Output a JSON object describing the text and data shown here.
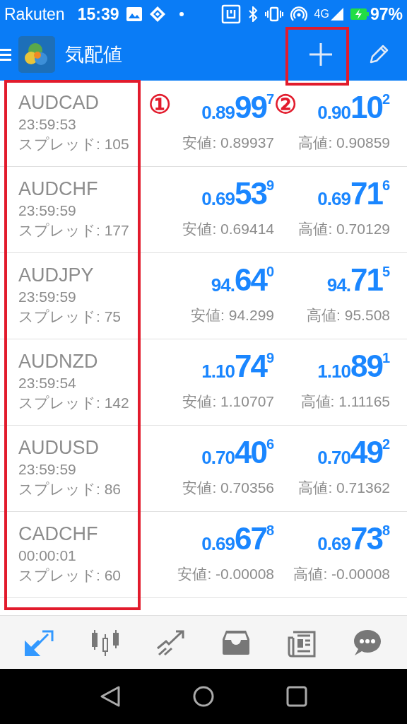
{
  "status_bar": {
    "carrier": "Rakuten",
    "time": "15:39",
    "network": "4G",
    "battery": "97%"
  },
  "app_bar": {
    "title": "気配値"
  },
  "quotes": [
    {
      "symbol": "AUDCAD",
      "time": "23:59:53",
      "spread": "スプレッド: 105",
      "bid": {
        "prefix": "0.89",
        "big": "99",
        "sup": "7",
        "marker": "①"
      },
      "ask": {
        "prefix": "0.90",
        "big": "10",
        "sup": "2",
        "marker": "②"
      },
      "low": "安値: 0.89937",
      "high": "高値: 0.90859"
    },
    {
      "symbol": "AUDCHF",
      "time": "23:59:59",
      "spread": "スプレッド: 177",
      "bid": {
        "prefix": "0.69",
        "big": "53",
        "sup": "9"
      },
      "ask": {
        "prefix": "0.69",
        "big": "71",
        "sup": "6"
      },
      "low": "安値: 0.69414",
      "high": "高値: 0.70129"
    },
    {
      "symbol": "AUDJPY",
      "time": "23:59:59",
      "spread": "スプレッド: 75",
      "bid": {
        "prefix": "94.",
        "big": "64",
        "sup": "0"
      },
      "ask": {
        "prefix": "94.",
        "big": "71",
        "sup": "5"
      },
      "low": "安値: 94.299",
      "high": "高値: 95.508"
    },
    {
      "symbol": "AUDNZD",
      "time": "23:59:54",
      "spread": "スプレッド: 142",
      "bid": {
        "prefix": "1.10",
        "big": "74",
        "sup": "9"
      },
      "ask": {
        "prefix": "1.10",
        "big": "89",
        "sup": "1"
      },
      "low": "安値: 1.10707",
      "high": "高値: 1.11165"
    },
    {
      "symbol": "AUDUSD",
      "time": "23:59:59",
      "spread": "スプレッド: 86",
      "bid": {
        "prefix": "0.70",
        "big": "40",
        "sup": "6"
      },
      "ask": {
        "prefix": "0.70",
        "big": "49",
        "sup": "2"
      },
      "low": "安値: 0.70356",
      "high": "高値: 0.71362"
    },
    {
      "symbol": "CADCHF",
      "time": "00:00:01",
      "spread": "スプレッド: 60",
      "bid": {
        "prefix": "0.69",
        "big": "67",
        "sup": "8"
      },
      "ask": {
        "prefix": "0.69",
        "big": "73",
        "sup": "8"
      },
      "low": "安値: -0.00008",
      "high": "高値: -0.00008"
    }
  ],
  "bottom_nav": [
    {
      "kind": "quotes",
      "selected": true
    },
    {
      "kind": "chart",
      "selected": false
    },
    {
      "kind": "trade",
      "selected": false
    },
    {
      "kind": "history",
      "selected": false
    },
    {
      "kind": "news",
      "selected": false
    },
    {
      "kind": "chat",
      "selected": false
    }
  ]
}
